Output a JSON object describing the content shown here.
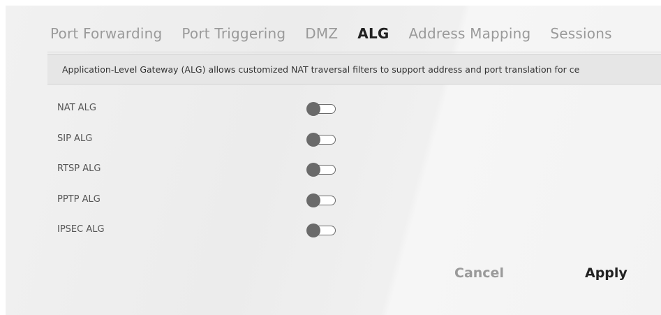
{
  "tabs": [
    {
      "label": "Port Forwarding",
      "active": false
    },
    {
      "label": "Port Triggering",
      "active": false
    },
    {
      "label": "DMZ",
      "active": false
    },
    {
      "label": "ALG",
      "active": true
    },
    {
      "label": "Address Mapping",
      "active": false
    },
    {
      "label": "Sessions",
      "active": false
    }
  ],
  "info": {
    "text": "Application-Level Gateway (ALG) allows customized NAT traversal filters to support address and port translation for ce"
  },
  "settings": [
    {
      "label": "NAT ALG",
      "enabled": false
    },
    {
      "label": "SIP ALG",
      "enabled": false
    },
    {
      "label": "RTSP ALG",
      "enabled": false
    },
    {
      "label": "PPTP ALG",
      "enabled": false
    },
    {
      "label": "IPSEC ALG",
      "enabled": false
    }
  ],
  "buttons": {
    "cancel": "Cancel",
    "apply": "Apply"
  },
  "colors": {
    "accent": "#f5b800",
    "toggle_off": "#6a6a6a"
  }
}
